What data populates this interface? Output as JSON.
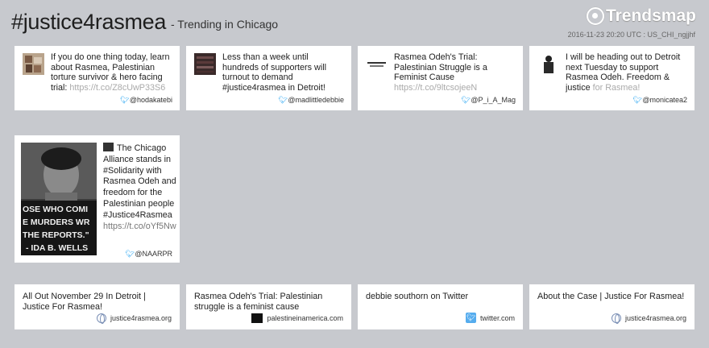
{
  "header": {
    "hashtag": "#justice4rasmea",
    "subtitle": "- Trending in Chicago",
    "brand": "Trendsmap",
    "meta": "2016-11-23 20:20 UTC : US_CHI_ngjjhf"
  },
  "tweets": [
    {
      "text": "If you do one thing today, learn about Rasmea, Palestinian torture survivor & hero facing trial:",
      "link": "https://t.co/Z8cUwP33S6",
      "user": "@hodakatebi"
    },
    {
      "text": "Less than a week until hundreds of supporters will turnout to demand #justice4rasmea in Detroit! Pitch in!",
      "link": "",
      "user": "@madlittledebbie"
    },
    {
      "text": "Rasmea Odeh's Trial: Palestinian Struggle is a Feminist Cause",
      "link": "https://t.co/9ltcsojeeN",
      "user": "@P_i_A_Mag"
    },
    {
      "text": "I will be heading out to Detroit next Tuesday to support Rasmea Odeh. Freedom & justice",
      "link": "for Rasmea!",
      "user": "@monicatea2"
    }
  ],
  "featured": {
    "text": "The Chicago Alliance stands in #Solidarity with Rasmea Odeh and freedom for the Palestinian people #Justice4Rasmea",
    "link": "https://t.co/oYf5Nw",
    "user": "@NAARPR",
    "image_caption": "OSE WHO COMMIT THE MURDERS WRITE THE REPORTS.\" - IDA B. WELLS"
  },
  "links": [
    {
      "title": "All Out November 29 In Detroit | Justice For Rasmea!",
      "source": "justice4rasmea.org",
      "icon": "globe-icon"
    },
    {
      "title": "Rasmea Odeh's Trial: Palestinian struggle is a feminist cause",
      "source": "palestineinamerica.com",
      "icon": "site-logo-icon"
    },
    {
      "title": "debbie southorn on Twitter",
      "source": "twitter.com",
      "icon": "twitter-icon"
    },
    {
      "title": "About the Case | Justice For Rasmea!",
      "source": "justice4rasmea.org",
      "icon": "globe-icon"
    }
  ],
  "colors": {
    "background": "#c7c9ce",
    "twitter_blue": "#1da1f2"
  }
}
